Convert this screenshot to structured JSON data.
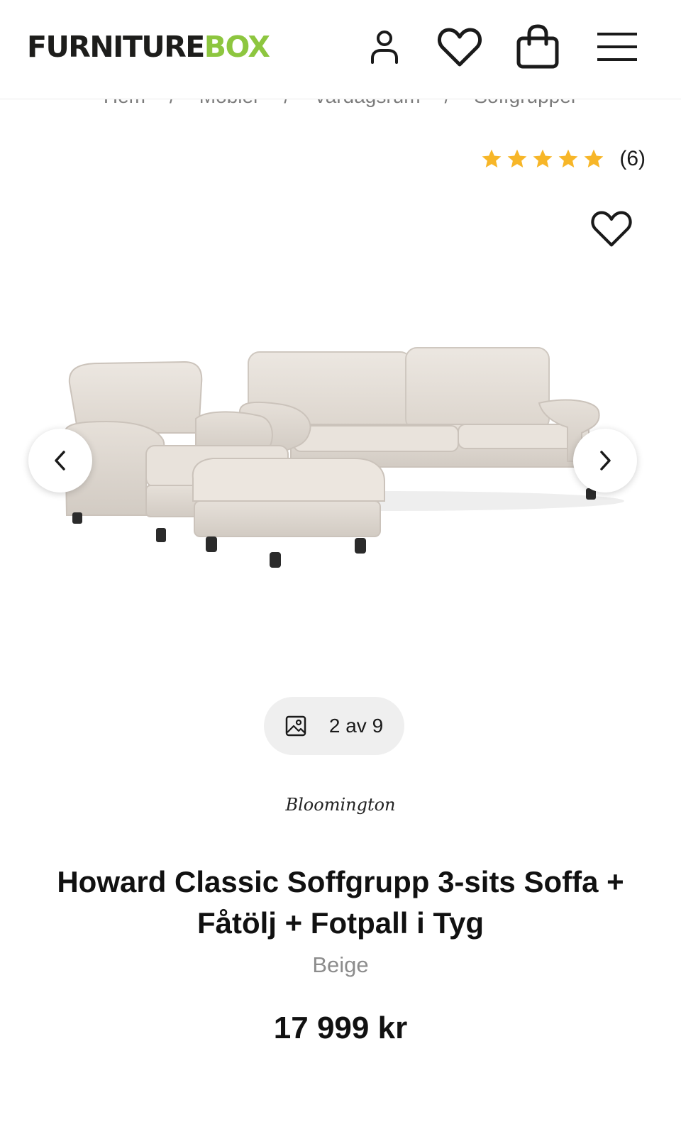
{
  "header": {
    "logo_part1": "FURNITURE",
    "logo_part2": "BOX",
    "brand_color": "#8dc63f",
    "icons": [
      "user-icon",
      "heart-icon",
      "shopping-bag-icon",
      "menu-icon"
    ]
  },
  "breadcrumb": [
    "Hem",
    "Möbler",
    "Vardagsrum",
    "Soffgrupper"
  ],
  "rating": {
    "stars": 5,
    "count": "(6)",
    "star_color": "#f7b628"
  },
  "gallery": {
    "counter": "2 av 9",
    "current": 2,
    "total": 9
  },
  "product": {
    "brand": "Bloomington",
    "title": "Howard Classic Soffgrupp 3-sits Soffa + Fåtölj + Fotpall i Tyg",
    "color": "Beige",
    "price": "17 999 kr"
  }
}
